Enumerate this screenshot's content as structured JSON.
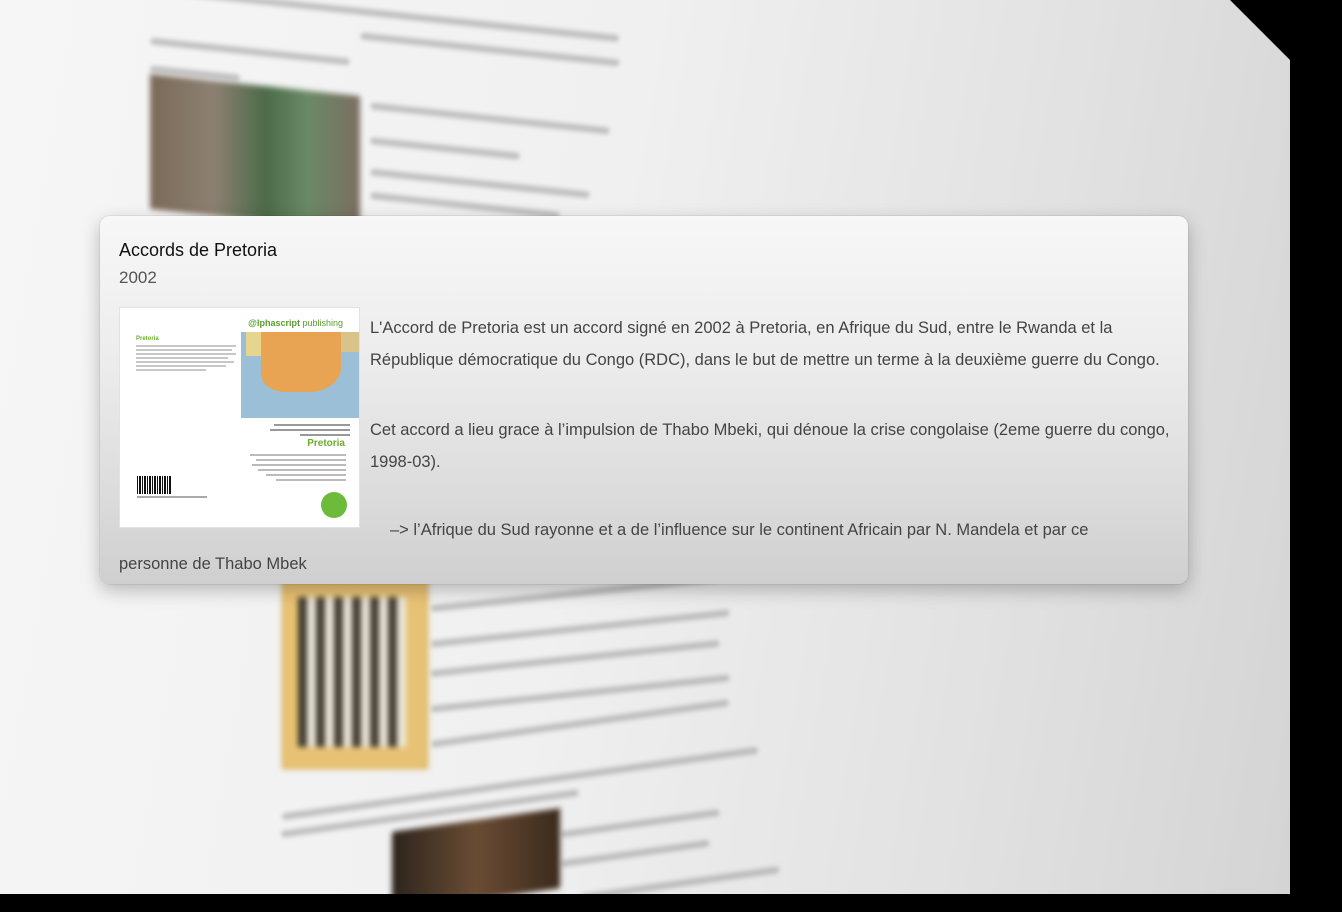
{
  "popover": {
    "title": "Accords de Pretoria",
    "year": "2002",
    "paragraphs": [
      "L'Accord de Pretoria est un accord signé en 2002 à Pretoria, en Afrique du Sud, entre le Rwanda et la République démocratique du Congo (RDC), dans le but de mettre un terme à la deuxième guerre du Congo.",
      "Cet accord a lieu grace à l’impulsion de Thabo Mbeki, qui dénoue la crise congolaise (2eme guerre du congo, 1998-03)."
    ],
    "tail_text": "–> l’Afrique du Sud rayonne et a de l’influence sur le continent Africain par N. Mandela et par ce personne de Thabo Mbek",
    "cover": {
      "publisher_prefix": "@lphascript",
      "publisher_suffix": " publishing",
      "heading": "Pretoria",
      "title": "Pretoria",
      "brand_color": "#6caf2d"
    }
  },
  "colors": {
    "card_top": "#f7f7f7",
    "card_bottom": "#cfcfcf",
    "text": "#444444"
  }
}
